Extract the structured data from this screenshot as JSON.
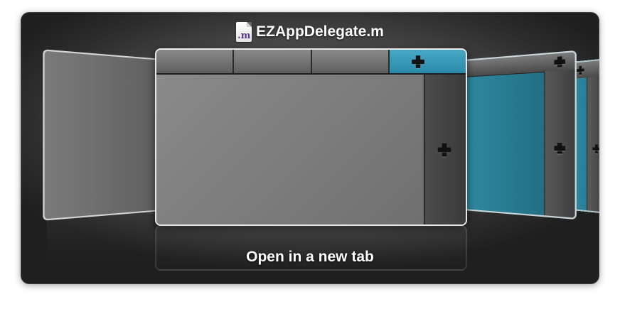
{
  "window": {
    "file_icon_ext": ".m",
    "file_name": "EZAppDelegate.m",
    "icon_name": "objc-source-file-icon"
  },
  "preview": {
    "tabs": [
      "",
      "",
      ""
    ],
    "active_tab_icon": "plus-icon",
    "accent_color": "#2b8aa8"
  },
  "caption": "Open in a new tab"
}
